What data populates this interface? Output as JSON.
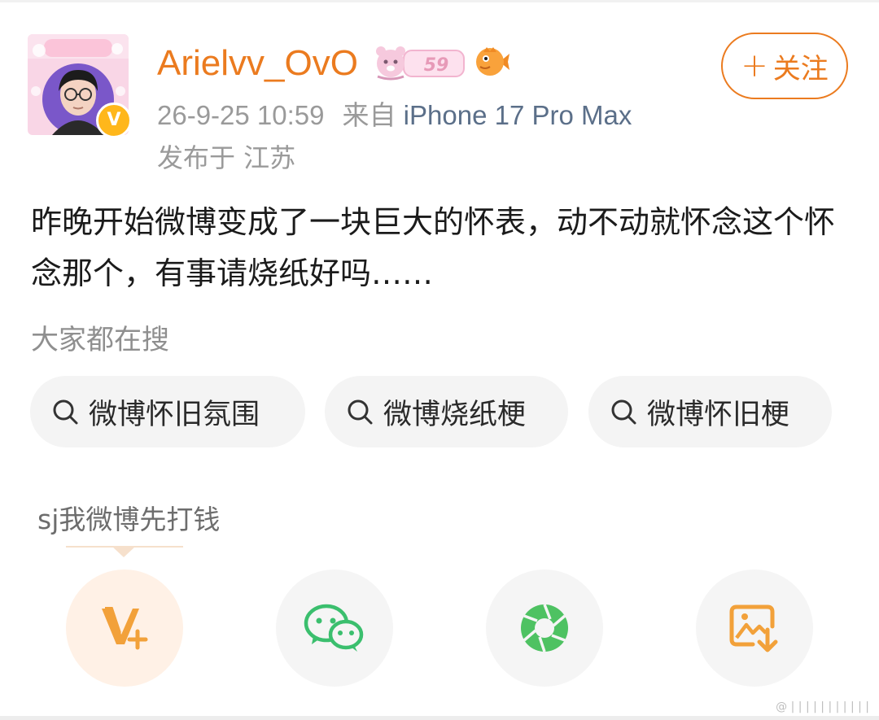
{
  "header": {
    "username": "Arielvv_OvO",
    "rank_badge_text": "59",
    "follow_button": "关注",
    "follow_plus": "+",
    "timestamp": "26-9-25 10:59",
    "source_prefix": "来自",
    "device": "iPhone 17 Pro Max",
    "location": "发布于 江苏",
    "verified_mark": "V"
  },
  "post": {
    "text": "昨晚开始微博变成了一块巨大的怀表，动不动就怀念这个怀念那个，有事请烧纸好吗……"
  },
  "search": {
    "title": "大家都在搜",
    "chips": [
      "微博怀旧氛围",
      "微博烧纸梗",
      "微博怀旧梗"
    ]
  },
  "share": {
    "caption": "sj我微博先打钱",
    "buttons": [
      "vplus-share",
      "wechat",
      "wechat-moments",
      "save-image"
    ]
  },
  "colors": {
    "accent": "#eb7b1f",
    "device_link": "#5b6f89",
    "wechat_green": "#3bbf6e"
  },
  "watermark": "@ | | | | | | | | | | |"
}
